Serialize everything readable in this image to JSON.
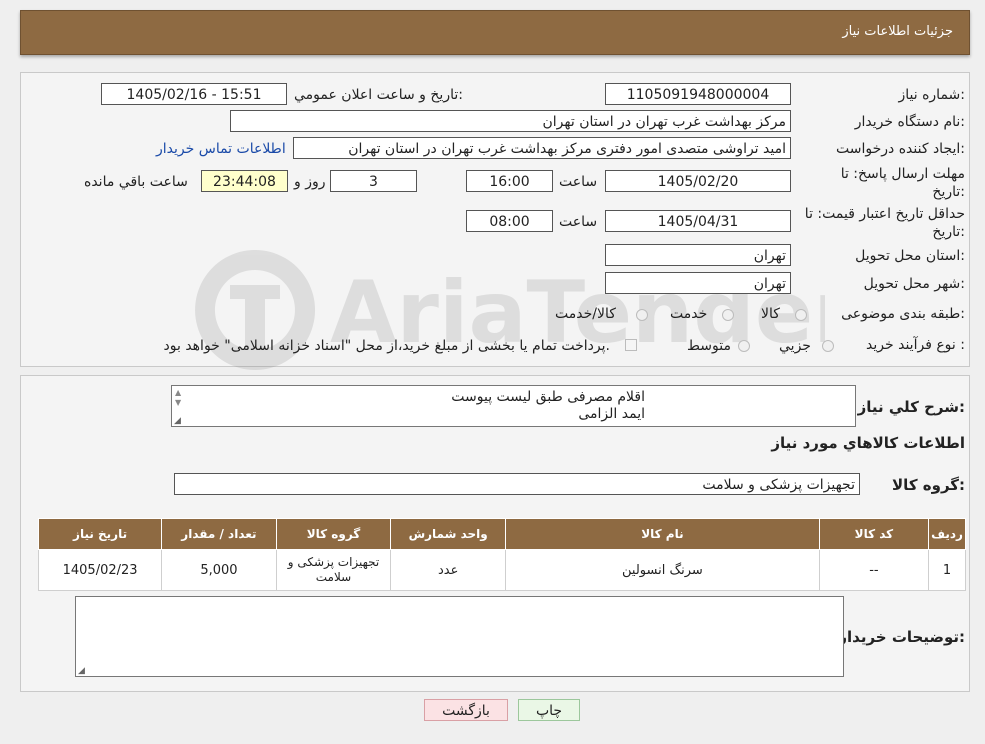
{
  "header": {
    "title": "جزئیات اطلاعات نیاز"
  },
  "form": {
    "need_number_label": "شماره نیاز:",
    "need_number": "1105091948000004",
    "announce_label": "تاریخ و ساعت اعلان عمومي:",
    "announce_value": "1405/02/16 - 15:51",
    "buyer_org_label": "نام دستگاه خريدار:",
    "buyer_org": "مرکز بهداشت غرب تهران در استان تهران",
    "creator_label": "ایجاد کننده درخواست:",
    "creator": "امید تراوشی متصدی امور دفتری مرکز بهداشت غرب تهران در استان تهران",
    "contact_link": "اطلاعات تماس خریدار",
    "deadline_label_1": "مهلت ارسال پاسخ: تا",
    "deadline_label_2": "تاریخ:",
    "deadline_date": "1405/02/20",
    "time_label": "ساعت",
    "deadline_time": "16:00",
    "days_value": "3",
    "days_label": "روز و",
    "remaining_time": "23:44:08",
    "remaining_label": "ساعت باقي مانده",
    "price_valid_label_1": "حداقل تاريخ اعتبار قيمت: تا",
    "price_valid_label_2": "تاريخ:",
    "price_valid_date": "1405/04/31",
    "price_valid_time": "08:00",
    "province_label": "استان محل تحویل:",
    "province": "تهران",
    "city_label": "شهر محل تحویل:",
    "city": "تهران",
    "category_label": "طبقه بندی موضوعی:",
    "category_options": [
      "کالا",
      "خدمت",
      "کالا/خدمت"
    ],
    "process_label": "نوع فرآیند خرید :",
    "process_options": [
      "جزيي",
      "متوسط"
    ],
    "payment_note": "پرداخت تمام یا بخشی از مبلغ خرید،از محل \"اسناد خزانه اسلامی\" خواهد بود."
  },
  "description": {
    "label": "شرح كلي نياز:",
    "lines": [
      "اقلام مصرفی طبق لیست پیوست",
      "ایمد الزامی"
    ]
  },
  "goods_section": {
    "title": "اطلاعات كالاهاي مورد نياز",
    "group_label": "گروه كالا:",
    "group_value": "تجهیزات پزشکی و سلامت"
  },
  "table": {
    "headers": [
      "رديف",
      "كد كالا",
      "نام كالا",
      "واحد شمارش",
      "گروه كالا",
      "تعداد / مقدار",
      "تاريخ نياز"
    ],
    "rows": [
      [
        "1",
        "--",
        "سرنگ انسولین",
        "عدد",
        "تجهیزات پزشکی و سلامت",
        "5,000",
        "1405/02/23"
      ]
    ]
  },
  "buyer_notes": {
    "label": "توضيحات خريدار:",
    "value": ""
  },
  "buttons": {
    "print": "چاپ",
    "back": "بازگشت"
  },
  "watermark": {
    "text": "AriaTender.neT"
  },
  "colors": {
    "header_bg": "#8e6a42",
    "link": "#1a4aa8",
    "print_bg": "#eaf7e6",
    "back_bg": "#fbe2e4"
  }
}
